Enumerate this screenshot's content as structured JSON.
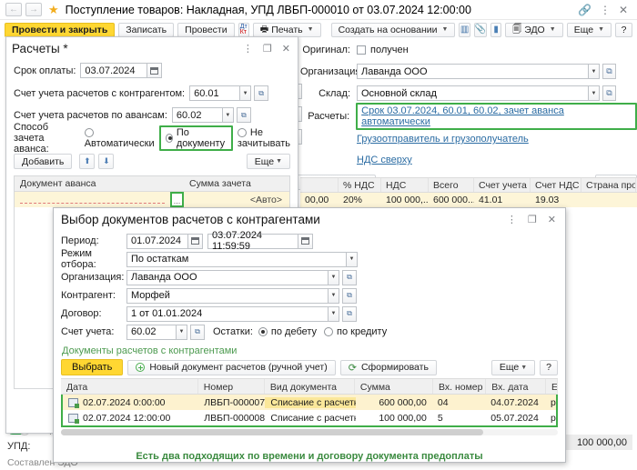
{
  "window": {
    "title": "Поступление товаров: Накладная, УПД ЛВБП-000010 от 03.07.2024 12:00:00",
    "back_icon": "←",
    "forward_icon": "→",
    "star_icon": "★",
    "link_icon": "🔗",
    "more_icon": "⋮",
    "close_icon": "✕"
  },
  "toolbar": {
    "post_and_close": "Провести и закрыть",
    "save": "Записать",
    "post": "Провести",
    "dtkt_icon": "Дт/Кт",
    "print": "Печать",
    "create_based_on": "Создать на основании",
    "report_icon": "report-icon",
    "attach_icon": "attach-icon",
    "note_icon": "note-icon",
    "edo": "ЭДО",
    "more": "Еще",
    "help": "?"
  },
  "document_form": {
    "original_label": "Оригинал:",
    "original_value": "получен",
    "organization_label": "Организация:",
    "organization_value": "Лаванда ООО",
    "warehouse_label": "Склад:",
    "warehouse_value": "Основной склад",
    "settlements_label": "Расчеты:",
    "settlements_link": "Срок 03.07.2024, 60.01, 60.02, зачет аванса автоматически",
    "shipper_link": "Грузоотправитель и грузополучатель",
    "vat_link": "НДС сверху",
    "barcode_button": "ь по штрихкоду",
    "more_button": "Еще",
    "grid_headers": [
      "",
      "% НДС",
      "НДС",
      "Всего",
      "Счет учета",
      "Счет НДС",
      "Страна происхож..."
    ],
    "grid_row": [
      "00,00",
      "20%",
      "100 000,...",
      "600 000...",
      "41.01",
      "19.03",
      ""
    ],
    "total_value": "100 000,00"
  },
  "upd_panel": {
    "toggle_label": "УПД",
    "upd_label": "УПД:",
    "status_label": "Составлен ЭДО"
  },
  "calc_window": {
    "title": "Расчеты *",
    "more_icon": "⋮",
    "maximize_icon": "❐",
    "close_icon": "✕",
    "payment_term_label": "Срок оплаты:",
    "payment_term_value": "03.07.2024",
    "account_counterparty_label": "Счет учета расчетов с контрагентом:",
    "account_counterparty_value": "60.01",
    "account_advance_label": "Счет учета расчетов по авансам:",
    "account_advance_value": "60.02",
    "offset_method_label": "Способ зачета аванса:",
    "offset_auto": "Автоматически",
    "offset_by_doc": "По документу",
    "offset_none": "Не зачитывать",
    "add_button": "Добавить",
    "up_icon": "⬆",
    "down_icon": "⬇",
    "more_button": "Еще",
    "table_headers": [
      "Документ аванса",
      "Сумма зачета"
    ],
    "row_amount": "<Авто>",
    "ellipsis_button": "..."
  },
  "modal": {
    "title": "Выбор документов расчетов с контрагентами",
    "more_icon": "⋮",
    "maximize_icon": "❐",
    "close_icon": "✕",
    "period_label": "Период:",
    "period_from": "01.07.2024",
    "period_to": "03.07.2024 11:59:59",
    "filter_mode_label": "Режим отбора:",
    "filter_mode_value": "По остаткам",
    "organization_label": "Организация:",
    "organization_value": "Лаванда ООО",
    "counterparty_label": "Контрагент:",
    "counterparty_value": "Морфей",
    "contract_label": "Договор:",
    "contract_value": "1 от 01.01.2024",
    "account_label": "Счет учета:",
    "account_value": "60.02",
    "balance_label": "Остатки:",
    "balance_debit": "по дебету",
    "balance_credit": "по кредиту",
    "section_title": "Документы расчетов с контрагентами",
    "select_button": "Выбрать",
    "new_doc_button": "Новый документ расчетов (ручной учет)",
    "refresh_button": "Сформировать",
    "more_button": "Еще",
    "help_button": "?",
    "table_headers": [
      "Дата",
      "Номер",
      "Вид документа",
      "Сумма",
      "Вх. номер",
      "Вх. дата",
      "Е"
    ],
    "rows": [
      {
        "date": "02.07.2024 0:00:00",
        "number": "ЛВБП-000007",
        "doc_type": "Списание с расчетног...",
        "amount": "600 000,00",
        "in_number": "04",
        "in_date": "04.07.2024",
        "extra": "р"
      },
      {
        "date": "02.07.2024 12:00:00",
        "number": "ЛВБП-000008",
        "doc_type": "Списание с расчетног...",
        "amount": "100 000,00",
        "in_number": "5",
        "in_date": "05.07.2024",
        "extra": "р"
      }
    ],
    "note": "Есть два подходящих по времени и договору документа предоплаты"
  },
  "colors": {
    "accent_yellow": "#ffd732",
    "highlight_green": "#3fae49",
    "link_blue": "#2b6ca3",
    "row_selected": "#fdf2cf"
  }
}
